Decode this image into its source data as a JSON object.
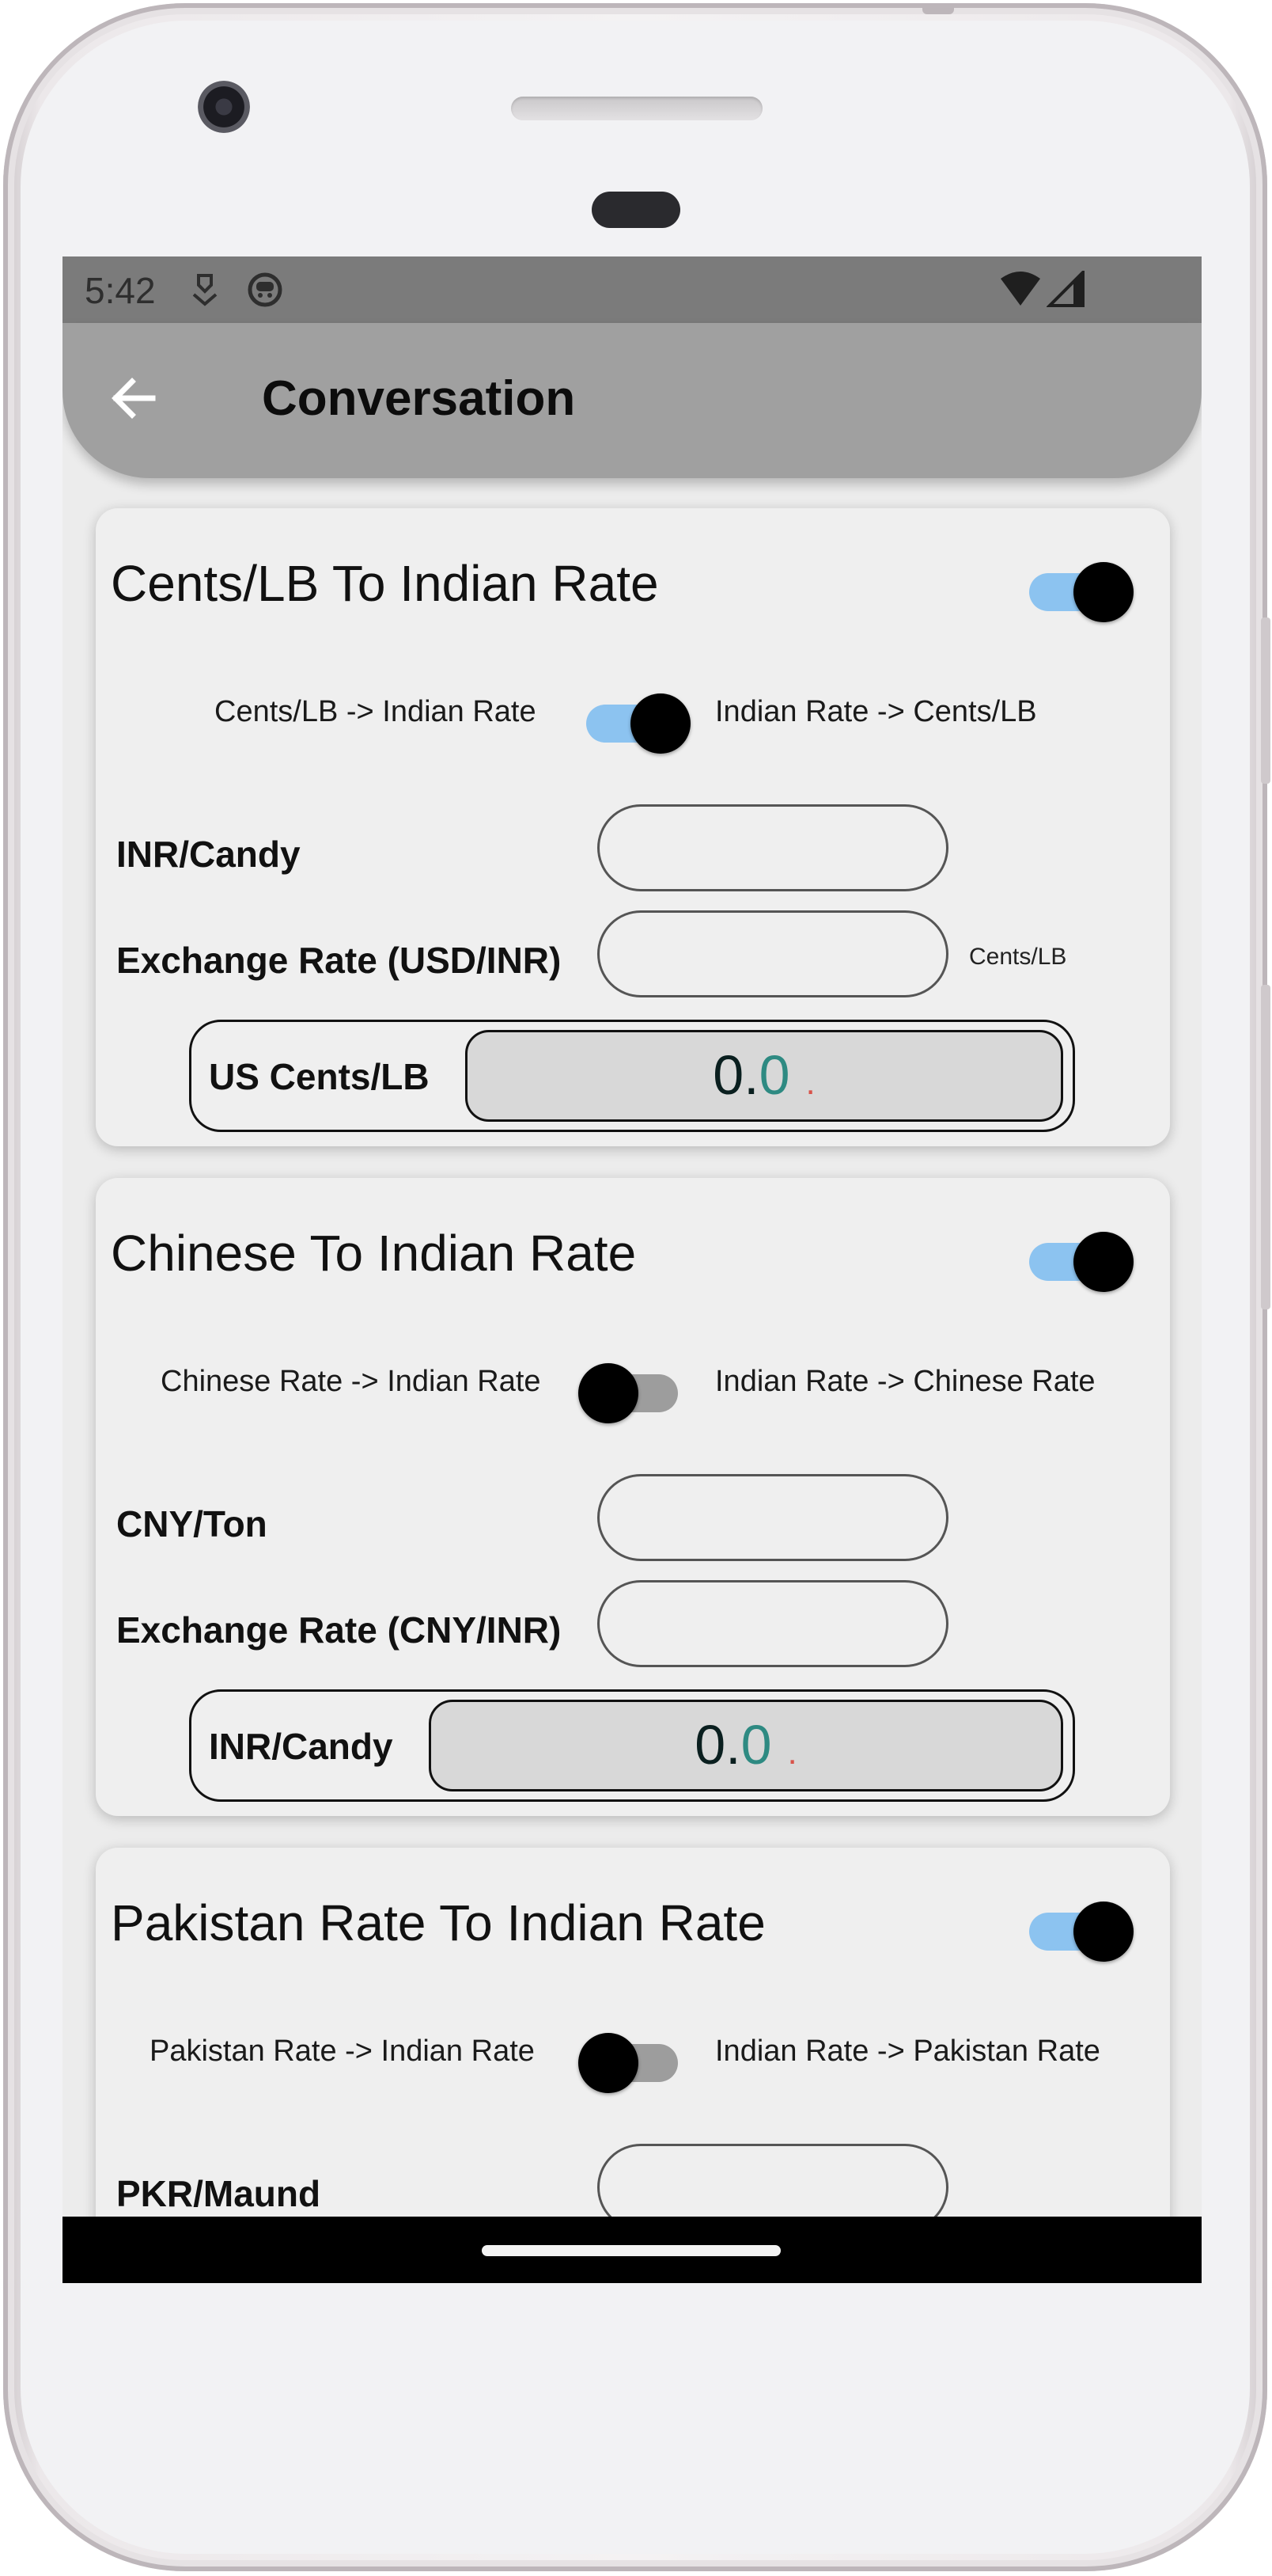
{
  "status_bar": {
    "time": "5:42",
    "icons": [
      "download-icon",
      "face-icon",
      "wifi-icon",
      "signal-icon"
    ]
  },
  "app_bar": {
    "back_icon": "arrow-left-icon",
    "title": "Conversation"
  },
  "cards": [
    {
      "title": "Cents/LB To Indian Rate",
      "enabled": true,
      "mode_left": "Cents/LB -> Indian Rate",
      "mode_right": "Indian Rate -> Cents/LB",
      "mode_switch_on": true,
      "fields": [
        {
          "label": "INR/Candy",
          "value": ""
        },
        {
          "label": "Exchange Rate (USD/INR)",
          "value": "",
          "unit": "Cents/LB"
        }
      ],
      "result": {
        "label": "US Cents/LB",
        "value_int": "0.",
        "value_dec": "0",
        "suffix": "."
      }
    },
    {
      "title": "Chinese To Indian Rate",
      "enabled": true,
      "mode_left": "Chinese Rate -> Indian Rate",
      "mode_right": "Indian Rate -> Chinese Rate",
      "mode_switch_on": false,
      "fields": [
        {
          "label": "CNY/Ton",
          "value": ""
        },
        {
          "label": "Exchange Rate (CNY/INR)",
          "value": ""
        }
      ],
      "result": {
        "label": "INR/Candy",
        "value_int": "0.",
        "value_dec": "0",
        "suffix": "."
      }
    },
    {
      "title": "Pakistan Rate To Indian Rate",
      "enabled": true,
      "mode_left": "Pakistan Rate -> Indian Rate",
      "mode_right": "Indian Rate -> Pakistan Rate",
      "mode_switch_on": false,
      "fields": [
        {
          "label": "PKR/Maund",
          "value": ""
        }
      ]
    }
  ],
  "colors": {
    "switch_on_track": "#8cc3f0",
    "switch_off_track": "#9d9d9d",
    "appbar": "#a0a0a0",
    "statusbar": "#7b7b7b",
    "result_decimal": "#2e8a82",
    "result_suffix": "#d8534a"
  }
}
